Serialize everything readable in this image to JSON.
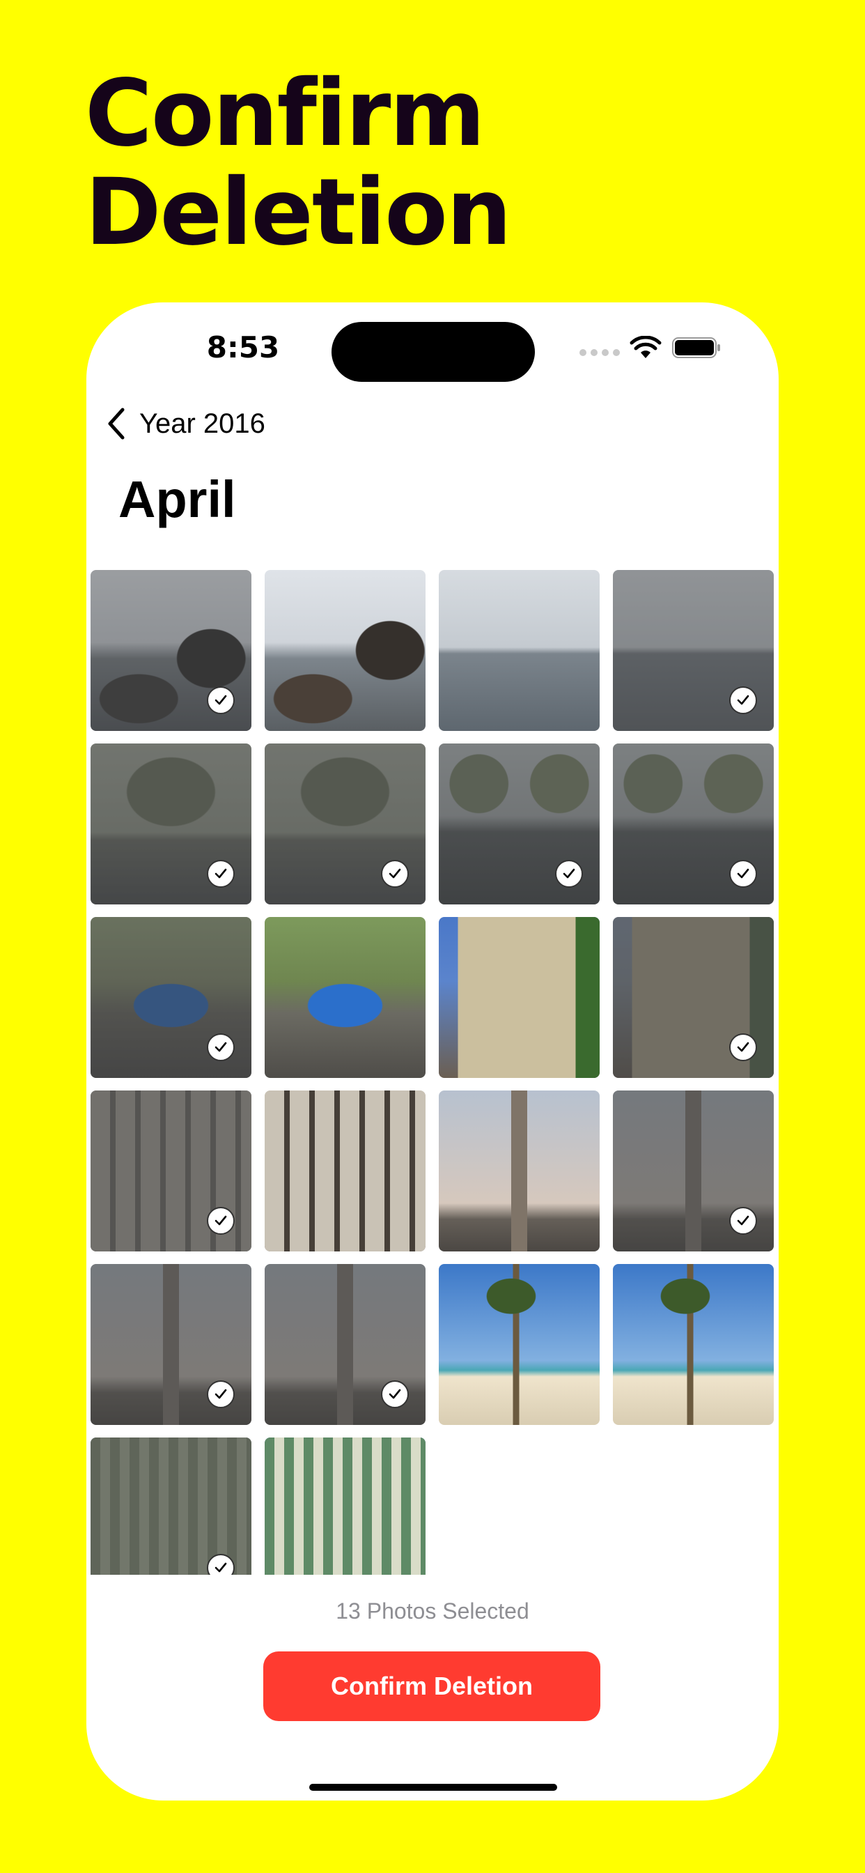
{
  "headline": {
    "line1": "Confirm",
    "line2": "Deletion"
  },
  "status_bar": {
    "time": "8:53"
  },
  "nav": {
    "back_label": "Year 2016"
  },
  "page": {
    "title": "April"
  },
  "photos": [
    {
      "scene": "rocks-coast",
      "selected": true
    },
    {
      "scene": "rocks-coast-clear",
      "selected": false
    },
    {
      "scene": "bay-bridge",
      "selected": false
    },
    {
      "scene": "bay-bridge-foggy",
      "selected": true
    },
    {
      "scene": "tree-house",
      "selected": true
    },
    {
      "scene": "tree-house",
      "selected": true
    },
    {
      "scene": "street-park",
      "selected": true
    },
    {
      "scene": "street-park",
      "selected": true
    },
    {
      "scene": "blue-car",
      "selected": true
    },
    {
      "scene": "blue-car-clear",
      "selected": false
    },
    {
      "scene": "building-clear",
      "selected": false
    },
    {
      "scene": "building",
      "selected": true
    },
    {
      "scene": "arcade-building",
      "selected": true
    },
    {
      "scene": "arcade-building-clear",
      "selected": false
    },
    {
      "scene": "obelisk-clear",
      "selected": false
    },
    {
      "scene": "obelisk",
      "selected": true
    },
    {
      "scene": "obelisk",
      "selected": true
    },
    {
      "scene": "obelisk",
      "selected": true
    },
    {
      "scene": "palm-beach",
      "selected": false
    },
    {
      "scene": "palm-beach",
      "selected": false
    },
    {
      "scene": "awning-building",
      "selected": true
    },
    {
      "scene": "awning-building-clear",
      "selected": false
    }
  ],
  "footer": {
    "selected_count": "13 Photos Selected",
    "confirm_label": "Confirm Deletion"
  },
  "colors": {
    "background": "#FFFF00",
    "headline": "#15041A",
    "destructive": "#FF3B30",
    "secondary_text": "#8E8E93"
  }
}
